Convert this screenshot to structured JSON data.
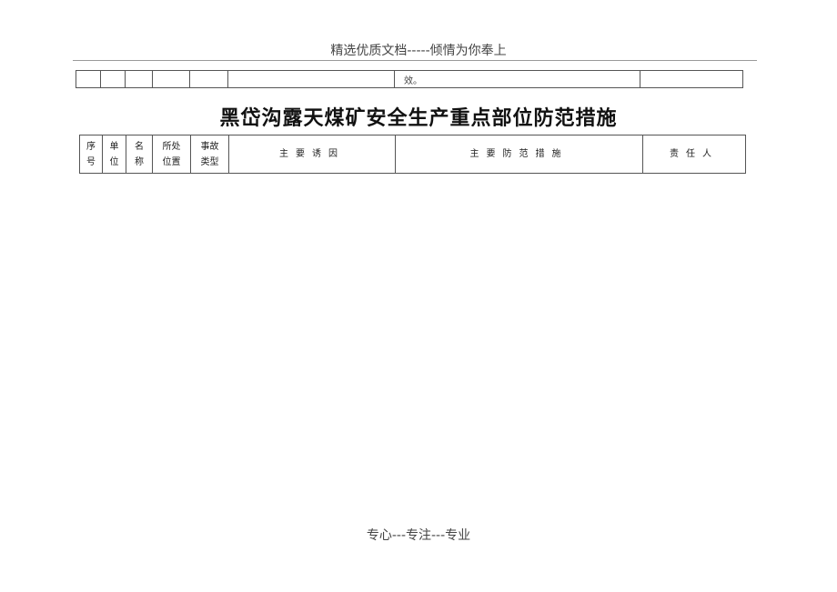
{
  "page_header": "精选优质文档-----倾情为你奉上",
  "previous_table_fragment": {
    "cells": [
      "",
      "",
      "",
      "",
      "",
      "",
      "效。",
      ""
    ]
  },
  "document_title": "黑岱沟露天煤矿安全生产重点部位防范措施",
  "table": {
    "headers": [
      {
        "line1": "序",
        "line2": "号"
      },
      {
        "line1": "单",
        "line2": "位"
      },
      {
        "line1": "名",
        "line2": "称"
      },
      {
        "line1": "所处",
        "line2": "位置"
      },
      {
        "line1": "事故",
        "line2": "类型"
      },
      {
        "label": "主要诱因"
      },
      {
        "label": "主要防范措施"
      },
      {
        "label": "责任人"
      }
    ]
  },
  "page_footer": "专心---专注---专业"
}
